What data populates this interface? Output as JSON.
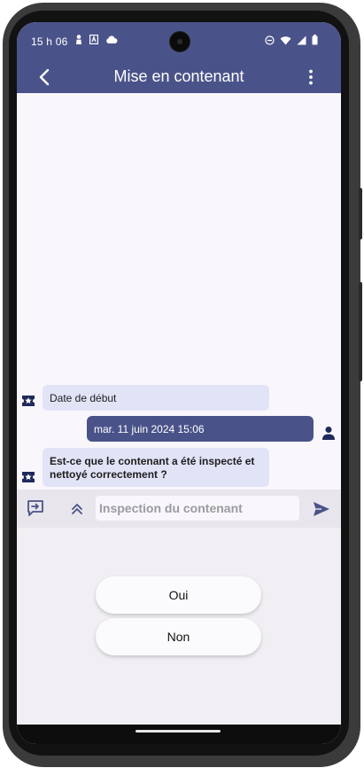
{
  "status_bar": {
    "time": "15 h 06",
    "left_icons": [
      "person-icon",
      "a-notification-icon",
      "cloud-icon"
    ],
    "right_icons": [
      "do-not-disturb-icon",
      "wifi-icon",
      "signal-icon",
      "battery-icon"
    ]
  },
  "app_bar": {
    "title": "Mise en contenant",
    "back_icon": "chevron-left-icon",
    "menu_icon": "more-vert-icon"
  },
  "chat": {
    "messages": [
      {
        "sender": "bot",
        "text": "Date de début"
      },
      {
        "sender": "user",
        "text": "mar. 11 juin 2024 15:06"
      },
      {
        "sender": "bot",
        "text": "Est-ce que le contenant a été inspecté et nettoyé correctement ?"
      }
    ]
  },
  "input_bar": {
    "placeholder": "Inspection du contenant",
    "value": "",
    "left_icon": "present-to-chat-icon",
    "expand_icon": "double-chevron-up-icon",
    "send_icon": "send-icon"
  },
  "answers": {
    "options": [
      "Oui",
      "Non"
    ]
  },
  "colors": {
    "primary": "#4a5389",
    "bot_bubble": "#e1e3f7",
    "background": "#f9f7fb"
  }
}
